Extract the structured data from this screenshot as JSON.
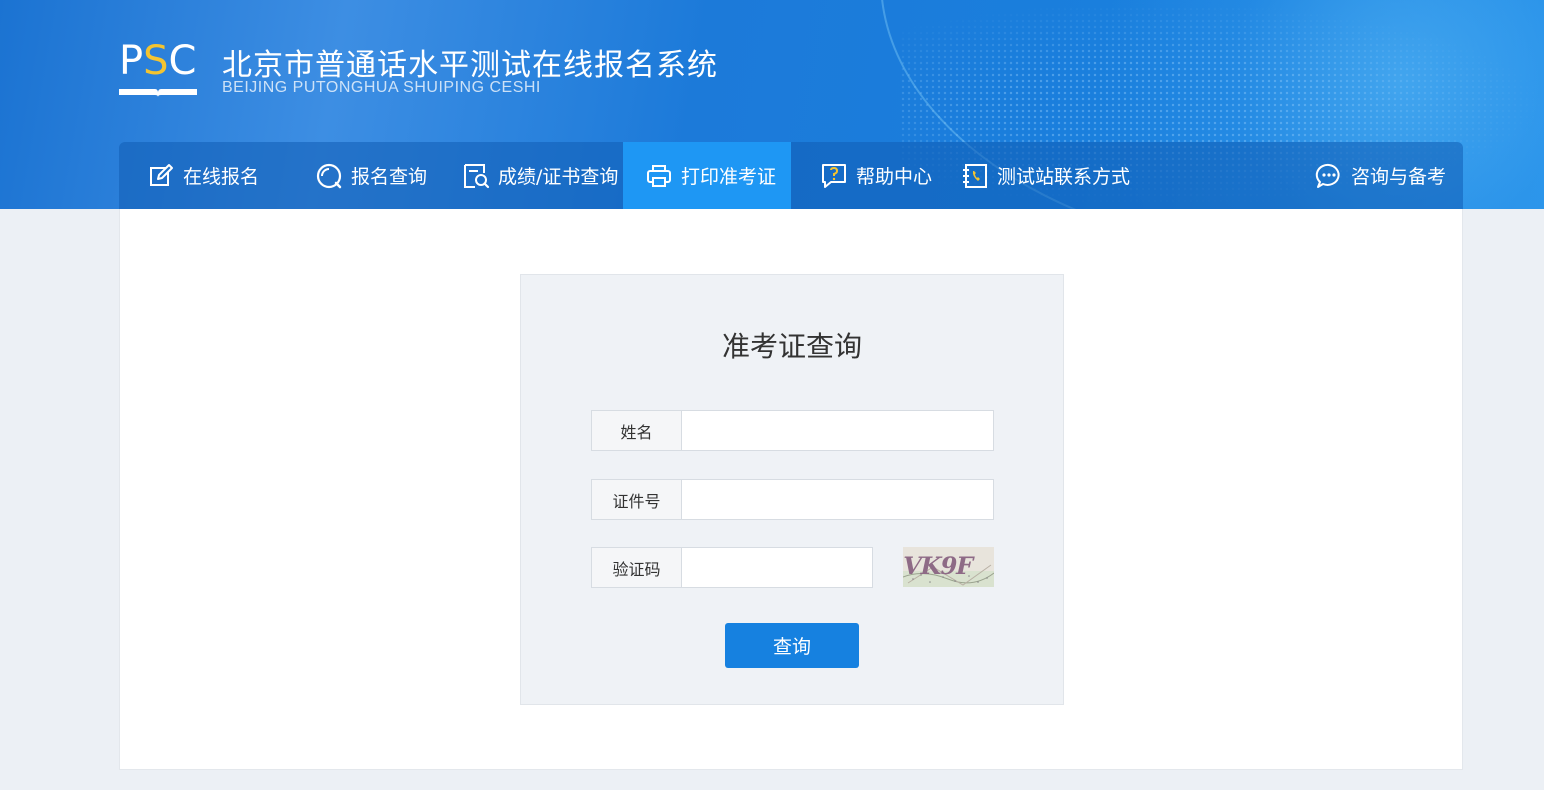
{
  "header": {
    "logo_text": "PSC",
    "title": "北京市普通话水平测试在线报名系统",
    "subtitle": "BEIJING PUTONGHUA SHUIPING CESHI"
  },
  "nav": {
    "items": [
      {
        "label": "在线报名",
        "icon": "edit-icon"
      },
      {
        "label": "报名查询",
        "icon": "search-circle-icon"
      },
      {
        "label": "成绩/证书查询",
        "icon": "document-search-icon"
      },
      {
        "label": "打印准考证",
        "icon": "printer-icon",
        "active": true
      },
      {
        "label": "帮助中心",
        "icon": "help-icon"
      },
      {
        "label": "测试站联系方式",
        "icon": "phone-book-icon"
      },
      {
        "label": "咨询与备考",
        "icon": "chat-icon"
      }
    ]
  },
  "form": {
    "title": "准考证查询",
    "fields": [
      {
        "label": "姓名",
        "value": ""
      },
      {
        "label": "证件号",
        "value": ""
      },
      {
        "label": "验证码",
        "value": ""
      }
    ],
    "captcha_text": "VK9F",
    "submit_label": "查询"
  },
  "colors": {
    "primary": "#1681e0",
    "nav_active": "#1e97f4",
    "banner": "#1b7ad8",
    "logo_accent": "#f4c430"
  }
}
